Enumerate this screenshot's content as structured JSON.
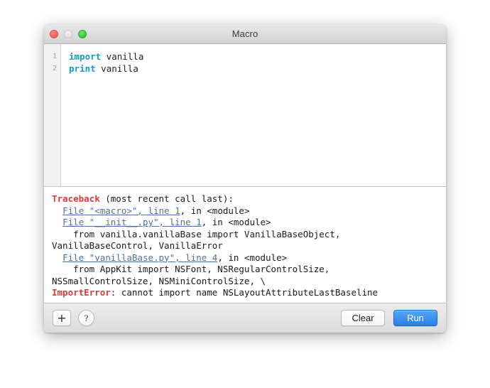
{
  "window": {
    "title": "Macro",
    "controls": {
      "close": "close-button",
      "minimize": "minimize-button",
      "zoom": "zoom-button"
    }
  },
  "editor": {
    "line_numbers": [
      "1",
      "2"
    ],
    "lines": [
      {
        "keyword": "import",
        "rest": " vanilla"
      },
      {
        "keyword": "print",
        "rest": " vanilla"
      }
    ]
  },
  "output": {
    "lines": [
      {
        "segments": [
          {
            "text": "Traceback",
            "style": "err"
          },
          {
            "text": " (most recent call last):",
            "style": "plain"
          }
        ]
      },
      {
        "segments": [
          {
            "text": "  ",
            "style": "plain"
          },
          {
            "text": "File \"<macro>\", line 1",
            "style": "link"
          },
          {
            "text": ", in <module>",
            "style": "plain"
          }
        ]
      },
      {
        "segments": [
          {
            "text": "  ",
            "style": "plain"
          },
          {
            "text": "File \"__init__.py\", line 1",
            "style": "link"
          },
          {
            "text": ", in <module>",
            "style": "plain"
          }
        ]
      },
      {
        "segments": [
          {
            "text": "    from vanilla.vanillaBase import VanillaBaseObject,",
            "style": "plain"
          }
        ]
      },
      {
        "segments": [
          {
            "text": "VanillaBaseControl, VanillaError",
            "style": "plain"
          }
        ]
      },
      {
        "segments": [
          {
            "text": "  ",
            "style": "plain"
          },
          {
            "text": "File \"vanillaBase.py\", line 4",
            "style": "link"
          },
          {
            "text": ", in <module>",
            "style": "plain"
          }
        ]
      },
      {
        "segments": [
          {
            "text": "    from AppKit import NSFont, NSRegularControlSize,",
            "style": "plain"
          }
        ]
      },
      {
        "segments": [
          {
            "text": "NSSmallControlSize, NSMiniControlSize, \\",
            "style": "plain"
          }
        ]
      },
      {
        "segments": [
          {
            "text": "ImportError",
            "style": "err"
          },
          {
            "text": ": cannot import name NSLayoutAttributeLastBaseline",
            "style": "plain"
          }
        ]
      }
    ]
  },
  "toolbar": {
    "add_label": "+",
    "help_label": "?",
    "clear_label": "Clear",
    "run_label": "Run"
  },
  "colors": {
    "keyword": "#0f9ec4",
    "error": "#e03b33",
    "link": "#4c6fa8",
    "run_button": "#2a7fe4"
  }
}
